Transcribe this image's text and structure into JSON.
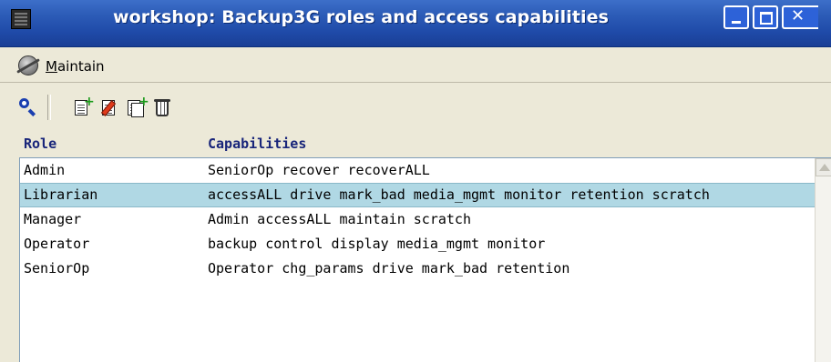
{
  "window": {
    "title": "workshop: Backup3G roles and access capabilities",
    "close_glyph": "✕"
  },
  "menu": {
    "icon": "planet-icon",
    "label_mnemonic": "M",
    "label_rest": "aintain"
  },
  "toolbar": {
    "icons": [
      "search-icon",
      "new-document-icon",
      "edit-document-icon",
      "copy-document-icon",
      "trash-icon"
    ]
  },
  "table": {
    "columns": [
      "Role",
      "Capabilities"
    ],
    "rows": [
      {
        "role": "Admin",
        "capabilities": "SeniorOp recover recoverALL"
      },
      {
        "role": "Librarian",
        "capabilities": "accessALL drive mark_bad media_mgmt monitor retention scratch"
      },
      {
        "role": "Manager",
        "capabilities": "Admin accessALL maintain scratch"
      },
      {
        "role": "Operator",
        "capabilities": "backup control display media_mgmt monitor"
      },
      {
        "role": "SeniorOp",
        "capabilities": "Operator chg_params drive mark_bad retention"
      }
    ],
    "selected_role": "Librarian"
  },
  "colors": {
    "titlebar": "#2d5db8",
    "selection": "#b0d8e4",
    "header_text": "#18257a"
  }
}
